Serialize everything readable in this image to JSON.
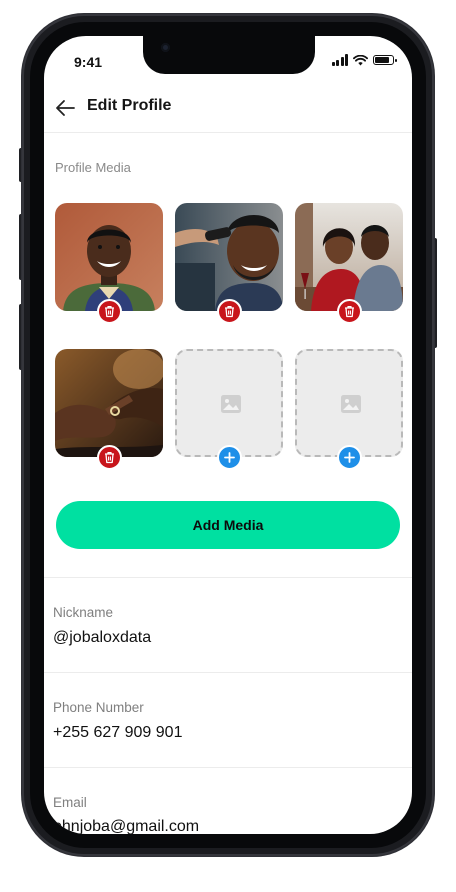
{
  "status_bar": {
    "time": "9:41",
    "signal_bars": 4,
    "battery_level": 0.85
  },
  "header": {
    "back_icon": "arrow-left-icon",
    "title": "Edit Profile"
  },
  "profile_media": {
    "label": "Profile Media",
    "tiles": [
      {
        "kind": "photo",
        "description_icon": "photo-man-smiling-icon",
        "action_icon": "trash-icon"
      },
      {
        "kind": "photo",
        "description_icon": "photo-man-haircut-icon",
        "action_icon": "trash-icon"
      },
      {
        "kind": "photo",
        "description_icon": "photo-couple-dinner-icon",
        "action_icon": "trash-icon"
      },
      {
        "kind": "photo",
        "description_icon": "photo-ring-hands-icon",
        "action_icon": "trash-icon"
      },
      {
        "kind": "empty",
        "description_icon": "image-placeholder-icon",
        "action_icon": "plus-icon"
      },
      {
        "kind": "empty",
        "description_icon": "image-placeholder-icon",
        "action_icon": "plus-icon"
      }
    ],
    "add_button_label": "Add Media"
  },
  "fields": {
    "nickname": {
      "label": "Nickname",
      "value": "@jobaloxdata"
    },
    "phone": {
      "label": "Phone Number",
      "value": "+255 627 909 901"
    },
    "email": {
      "label": "Email",
      "value": "ohnjoba@gmail.com"
    }
  },
  "colors": {
    "accent_button": "#00e0a1",
    "delete_badge": "#c8151b",
    "add_badge": "#1e8fe8",
    "label_text": "#8a8a8a",
    "value_text": "#111111"
  }
}
